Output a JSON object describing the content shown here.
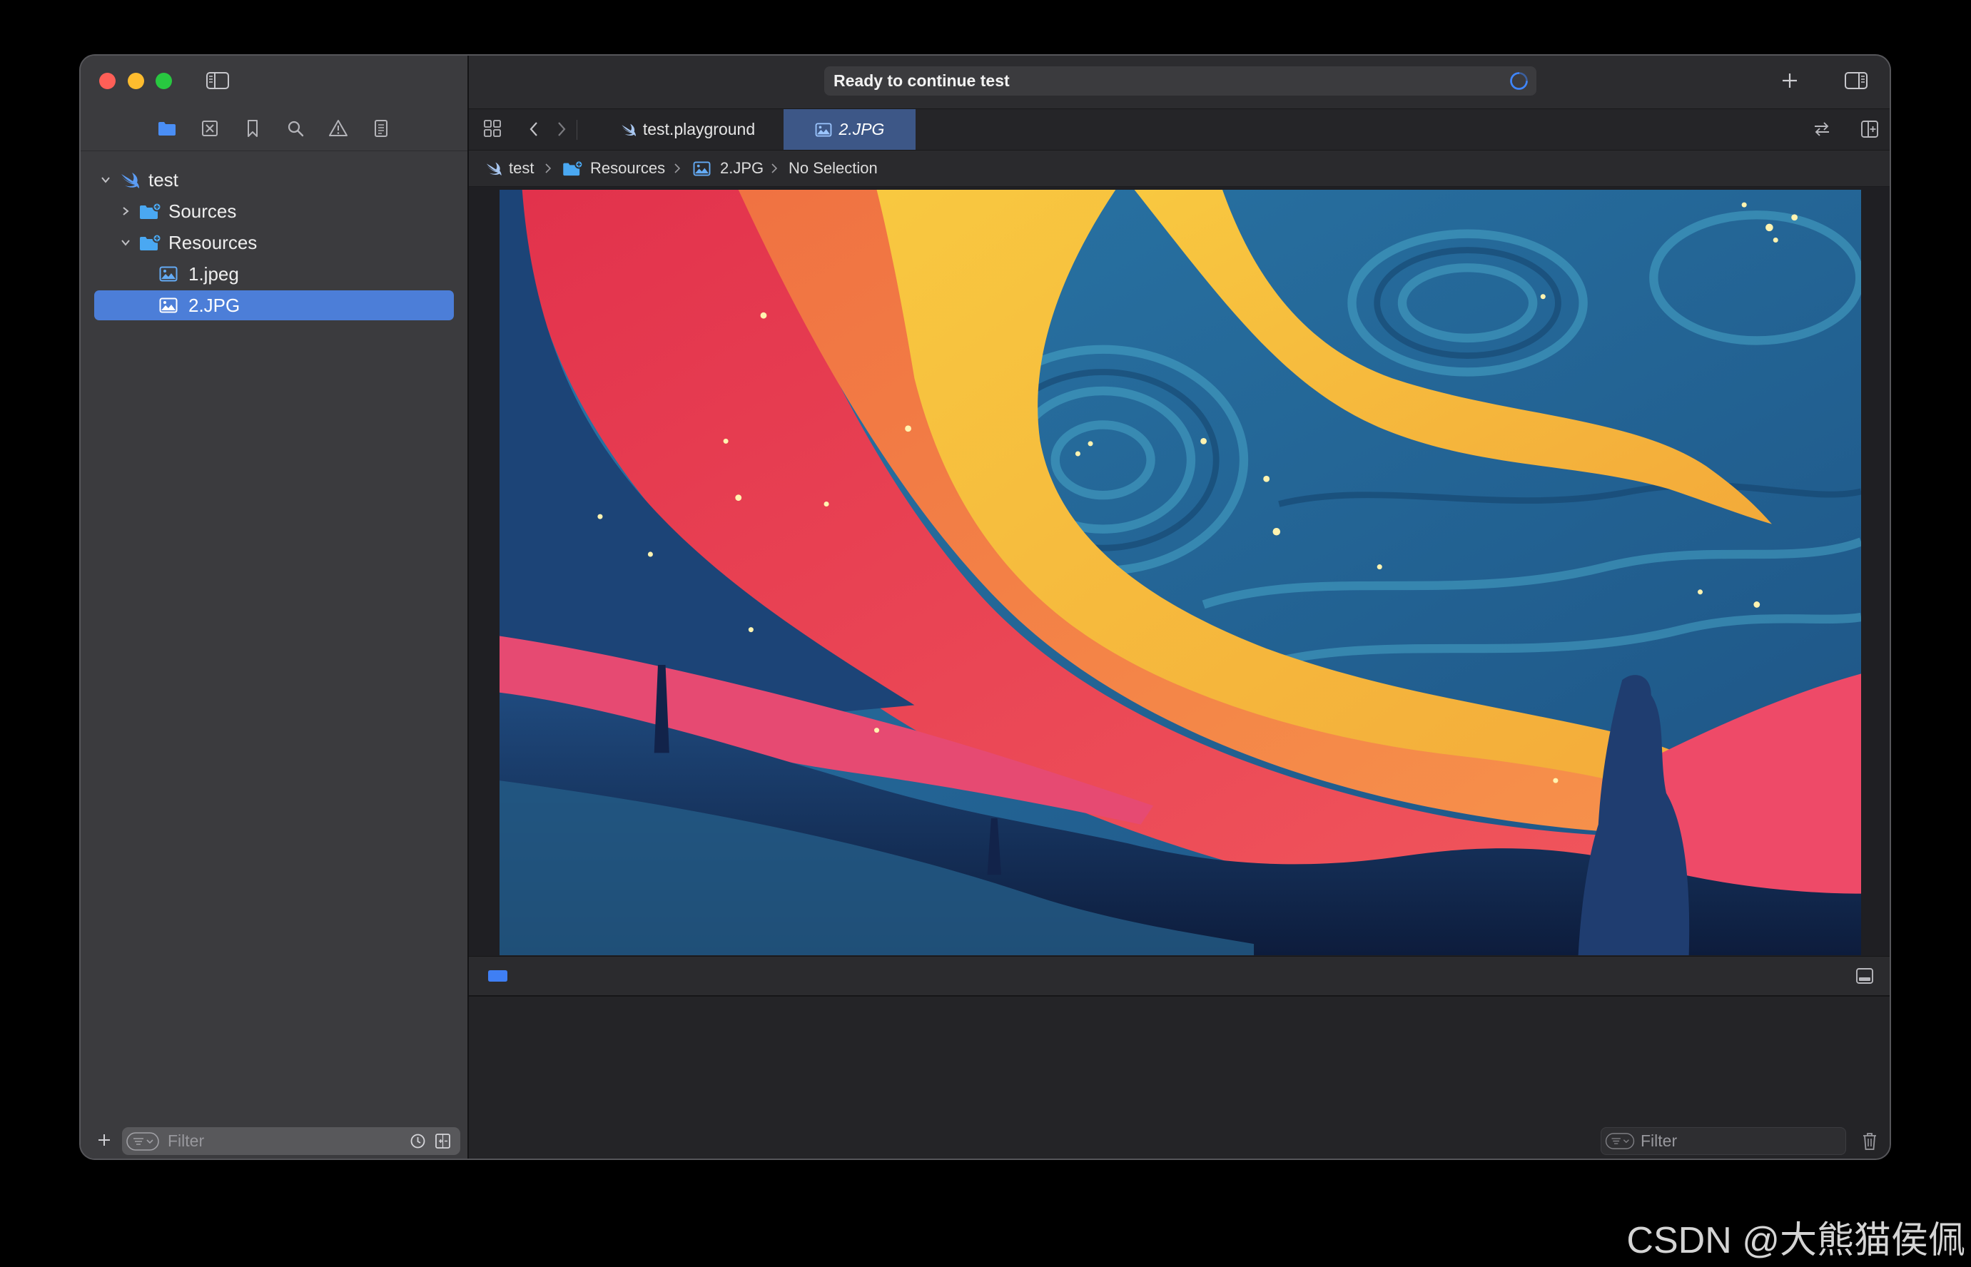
{
  "colors": {
    "close": "#ff5f57",
    "minimize": "#febc2e",
    "zoom": "#28c840",
    "selection": "#4c7ed8",
    "active_tab": "#3d5787",
    "accent": "#3f7ff4"
  },
  "toolbar": {
    "status_text": "Ready to continue test",
    "status_icon": "activity-spinner-icon",
    "left_icons": [
      "sidebar-toggle-icon"
    ],
    "right_icons": [
      "plus-icon",
      "inspector-toggle-icon"
    ]
  },
  "navigator": {
    "tab_icons": [
      "folder-icon",
      "source-control-icon",
      "bookmark-icon",
      "search-icon",
      "warning-icon",
      "report-icon"
    ],
    "tree": [
      {
        "label": "test",
        "icon": "swift-icon",
        "expanded": true
      },
      {
        "label": "Sources",
        "icon": "folder-badge-icon",
        "expanded": false
      },
      {
        "label": "Resources",
        "icon": "folder-badge-icon",
        "expanded": true
      },
      {
        "label": "1.jpeg",
        "icon": "image-icon"
      },
      {
        "label": "2.JPG",
        "icon": "image-icon",
        "selected": true
      }
    ],
    "filter_placeholder": "Filter",
    "filter_icons": [
      "filter-options-icon",
      "recent-files-icon",
      "source-control-filter-icon"
    ]
  },
  "editor": {
    "tab_bar_icons": [
      "grid-icon",
      "back-icon",
      "forward-icon",
      "swap-icon",
      "add-editor-icon"
    ],
    "tabs": [
      {
        "label": "test.playground",
        "icon": "swift-icon"
      },
      {
        "label": "2.JPG",
        "icon": "image-icon",
        "active": true
      }
    ],
    "breadcrumb": [
      {
        "label": "test",
        "icon": "swift-icon"
      },
      {
        "label": "Resources",
        "icon": "folder-badge-icon"
      },
      {
        "label": "2.JPG",
        "icon": "image-icon"
      },
      {
        "label": "No Selection"
      }
    ]
  },
  "debug_area": {
    "icons": [
      "console-toggle-icon",
      "hide-debug-area-icon",
      "trash-icon"
    ],
    "filter_placeholder": "Filter"
  },
  "watermark": "CSDN @大熊猫侯佩"
}
